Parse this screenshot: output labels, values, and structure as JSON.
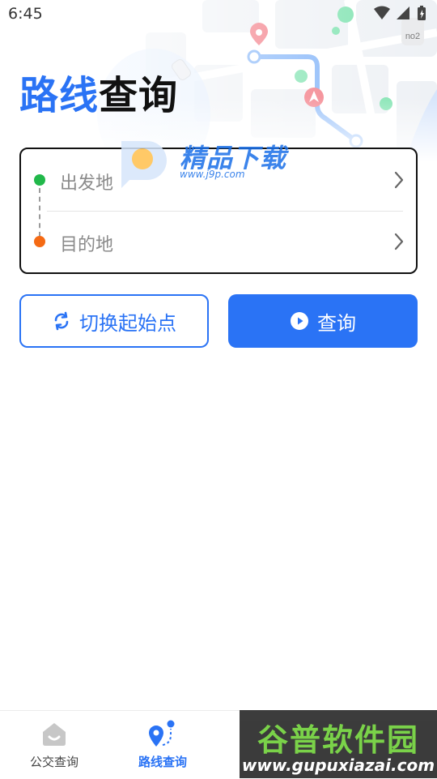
{
  "status_bar": {
    "time": "6:45",
    "icons": [
      "wifi-icon",
      "signal-icon",
      "battery-icon"
    ]
  },
  "header": {
    "title_accent": "路线",
    "title_main": "查询",
    "map_badge": "no2"
  },
  "route": {
    "start_placeholder": "出发地",
    "end_placeholder": "目的地"
  },
  "actions": {
    "swap_label": "切换起始点",
    "query_label": "查询"
  },
  "bottom_nav": {
    "items": [
      {
        "label": "公交查询",
        "icon": "bus-icon",
        "active": false
      },
      {
        "label": "路线查询",
        "icon": "route-icon",
        "active": true
      }
    ]
  },
  "watermarks": {
    "j9p_title": "精品下载",
    "j9p_url": "www.j9p.com",
    "gupu_title": "谷普软件园",
    "gupu_url": "www.gupuxiazai.com"
  },
  "colors": {
    "accent": "#2a73f5",
    "start_dot": "#21b84a",
    "end_dot": "#f56a14"
  }
}
